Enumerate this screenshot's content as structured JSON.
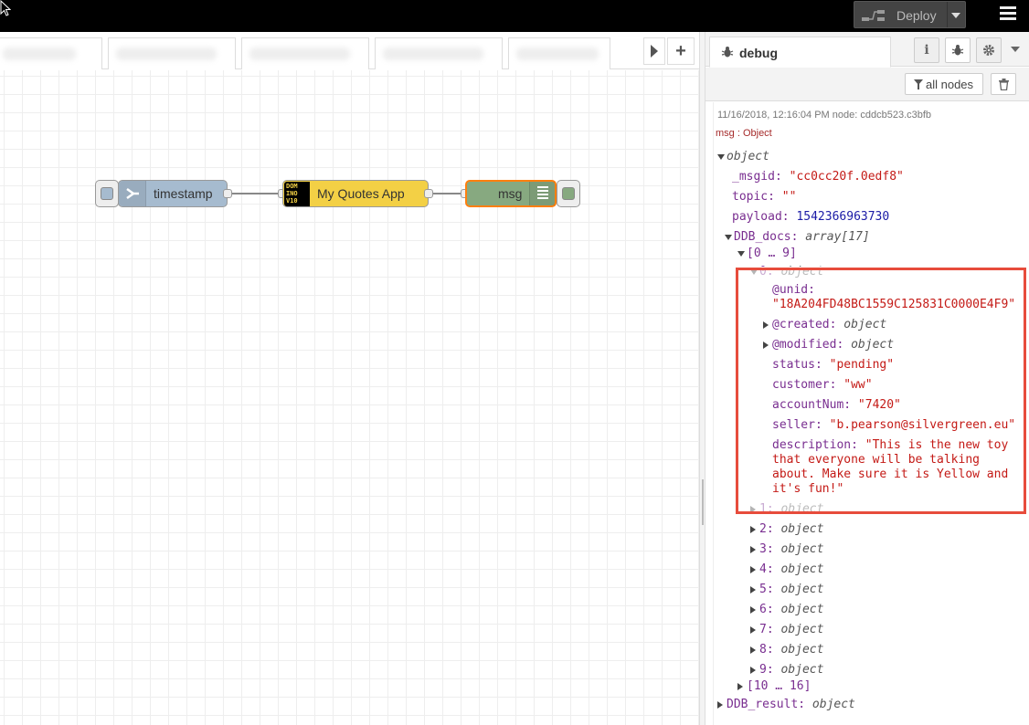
{
  "header": {
    "deploy_label": "Deploy"
  },
  "flow": {
    "nodes": [
      {
        "label": "timestamp"
      },
      {
        "label": "My Quotes App",
        "icon_text": [
          "DOM",
          "INO",
          "V10"
        ]
      },
      {
        "label": "msg"
      }
    ]
  },
  "sidebar": {
    "tab_label": "debug",
    "filter_label": "all nodes",
    "info_icon": "i"
  },
  "debug": {
    "meta": "11/16/2018, 12:16:04 PM   node: cddcb523.c3bfb",
    "topic_label": "msg : Object",
    "tree": [
      {
        "indent": 0,
        "caret": "down",
        "key": "",
        "sep": "",
        "value": "object",
        "vtype": "t"
      },
      {
        "indent": 1,
        "caret": "",
        "key": "_msgid",
        "sep": ": ",
        "value": "\"cc0cc20f.0edf8\"",
        "vtype": "s"
      },
      {
        "indent": 1,
        "caret": "",
        "key": "topic",
        "sep": ": ",
        "value": "\"\"",
        "vtype": "s"
      },
      {
        "indent": 1,
        "caret": "",
        "key": "payload",
        "sep": ": ",
        "value": "1542366963730",
        "vtype": "n"
      },
      {
        "indent": 1,
        "caret": "down",
        "key": "DDB_docs",
        "sep": ": ",
        "value": "array[17]",
        "vtype": "t"
      },
      {
        "indent": 2,
        "caret": "down",
        "key": "[0 … 9]",
        "sep": "",
        "value": "",
        "vtype": "t"
      },
      {
        "indent": 3,
        "caret": "down",
        "key": "0",
        "sep": ": ",
        "value": "object",
        "vtype": "t"
      },
      {
        "indent": 4,
        "caret": "",
        "key": "@unid",
        "sep": ":",
        "value": "",
        "vtype": "s"
      },
      {
        "indent": 4,
        "caret": "",
        "key": "",
        "sep": "",
        "value": "\"18A204FD48BC1559C125831C0000E4F9\"",
        "vtype": "s"
      },
      {
        "indent": 4,
        "caret": "right",
        "key": "@created",
        "sep": ": ",
        "value": "object",
        "vtype": "t"
      },
      {
        "indent": 4,
        "caret": "right",
        "key": "@modified",
        "sep": ": ",
        "value": "object",
        "vtype": "t"
      },
      {
        "indent": 4,
        "caret": "",
        "key": "status",
        "sep": ": ",
        "value": "\"pending\"",
        "vtype": "s"
      },
      {
        "indent": 4,
        "caret": "",
        "key": "customer",
        "sep": ": ",
        "value": "\"ww\"",
        "vtype": "s"
      },
      {
        "indent": 4,
        "caret": "",
        "key": "accountNum",
        "sep": ": ",
        "value": "\"7420\"",
        "vtype": "s"
      },
      {
        "indent": 4,
        "caret": "",
        "key": "seller",
        "sep": ": ",
        "value": "\"b.pearson@silvergreen.eu\"",
        "vtype": "s"
      },
      {
        "indent": 4,
        "caret": "",
        "key": "description",
        "sep": ": ",
        "value": "\"This is the new toy",
        "vtype": "s"
      },
      {
        "indent": 4,
        "caret": "",
        "key": "",
        "sep": "",
        "value": "that everyone will be talking",
        "vtype": "s"
      },
      {
        "indent": 4,
        "caret": "",
        "key": "",
        "sep": "",
        "value": "about. Make sure it is Yellow and",
        "vtype": "s"
      },
      {
        "indent": 4,
        "caret": "",
        "key": "",
        "sep": "",
        "value": "it's fun!\"",
        "vtype": "s"
      },
      {
        "indent": 3,
        "caret": "right",
        "key": "1",
        "sep": ": ",
        "value": "object",
        "vtype": "t"
      },
      {
        "indent": 3,
        "caret": "right",
        "key": "2",
        "sep": ": ",
        "value": "object",
        "vtype": "t"
      },
      {
        "indent": 3,
        "caret": "right",
        "key": "3",
        "sep": ": ",
        "value": "object",
        "vtype": "t"
      },
      {
        "indent": 3,
        "caret": "right",
        "key": "4",
        "sep": ": ",
        "value": "object",
        "vtype": "t"
      },
      {
        "indent": 3,
        "caret": "right",
        "key": "5",
        "sep": ": ",
        "value": "object",
        "vtype": "t"
      },
      {
        "indent": 3,
        "caret": "right",
        "key": "6",
        "sep": ": ",
        "value": "object",
        "vtype": "t"
      },
      {
        "indent": 3,
        "caret": "right",
        "key": "7",
        "sep": ": ",
        "value": "object",
        "vtype": "t"
      },
      {
        "indent": 3,
        "caret": "right",
        "key": "8",
        "sep": ": ",
        "value": "object",
        "vtype": "t"
      },
      {
        "indent": 3,
        "caret": "right",
        "key": "9",
        "sep": ": ",
        "value": "object",
        "vtype": "t"
      },
      {
        "indent": 2,
        "caret": "right",
        "key": "[10 … 16]",
        "sep": "",
        "value": "",
        "vtype": "t"
      },
      {
        "indent": 0,
        "caret": "right",
        "key": "DDB_result",
        "sep": ": ",
        "value": "object",
        "vtype": "t"
      }
    ]
  },
  "colors": {
    "header_bg": "#000000",
    "inject_node": "#a6bbcf",
    "domino_node": "#f3d045",
    "debug_node": "#87a980",
    "highlight": "#e74c3c"
  }
}
